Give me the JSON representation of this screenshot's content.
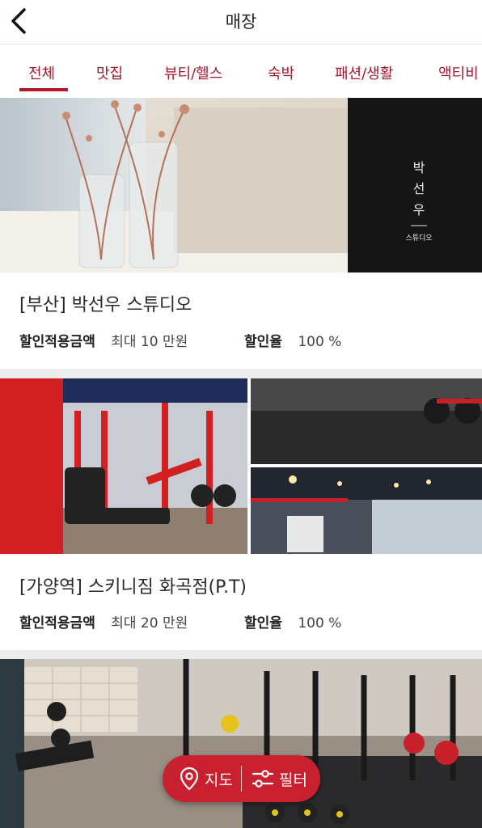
{
  "header": {
    "title": "매장",
    "back_icon": "chevron-left-icon"
  },
  "tabs": [
    {
      "label": "전체",
      "active": true
    },
    {
      "label": "맛집"
    },
    {
      "label": "뷰티/헬스"
    },
    {
      "label": "숙박"
    },
    {
      "label": "패션/생활"
    },
    {
      "label": "액티비"
    }
  ],
  "stores": [
    {
      "name": "[부산] 박선우 스튜디오",
      "discount_limit_label": "할인적용금액",
      "discount_limit_value": "최대 10 만원",
      "discount_rate_label": "할인율",
      "discount_rate_value": "100 %",
      "image_sign": "박\n선\n우",
      "image_sub": "스튜디오"
    },
    {
      "name": "[가양역] 스키니짐 화곡점(P.T)",
      "discount_limit_label": "할인적용금액",
      "discount_limit_value": "최대 20 만원",
      "discount_rate_label": "할인율",
      "discount_rate_value": "100 %"
    }
  ],
  "fab": {
    "map_label": "지도",
    "filter_label": "필터",
    "map_icon": "map-pin-icon",
    "filter_icon": "sliders-icon"
  },
  "colors": {
    "accent": "#c8202f",
    "tab_text": "#a5172a"
  }
}
